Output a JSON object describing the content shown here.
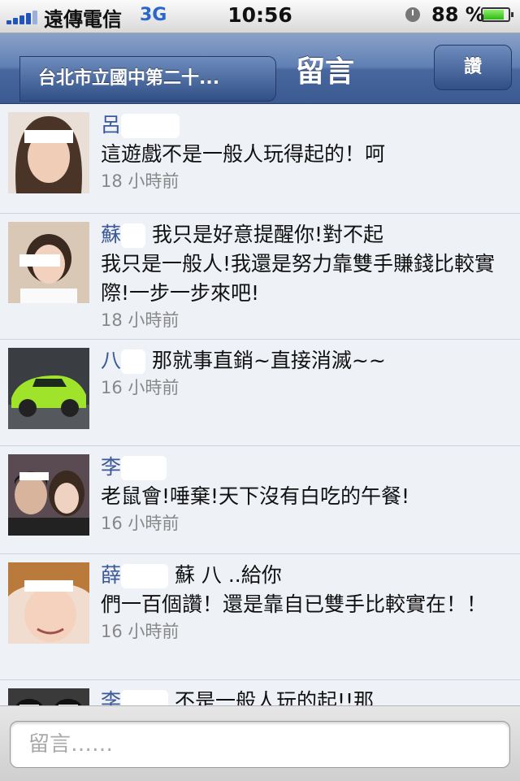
{
  "status_bar": {
    "carrier": "遠傳電信",
    "network": "3G",
    "time": "10:56",
    "battery_percent": "88 %",
    "battery_level": 0.88
  },
  "nav": {
    "back_label": "台北市立國中第二十...",
    "title": "留言",
    "like_label": "讚"
  },
  "comments": [
    {
      "name": "呂",
      "line1": "",
      "text": "這遊戲不是一般人玩得起的！呵",
      "time": "18 小時前",
      "avatar": "woman-photo"
    },
    {
      "name": "蘇",
      "line1": "我只是好意提醒你!對不起",
      "text": "我只是一般人!我還是努力靠雙手賺錢比較實際!一步一步來吧!",
      "time": "18 小時前",
      "avatar": "woman-photo"
    },
    {
      "name": "八",
      "line1": "那就事直銷~直接消滅~~",
      "text": "",
      "time": "16 小時前",
      "avatar": "green-car-photo"
    },
    {
      "name": "李",
      "line1": "",
      "text": "老鼠會!唾棄!天下沒有白吃的午餐!",
      "time": "16 小時前",
      "avatar": "couple-photo"
    },
    {
      "name": "薛",
      "line1": "蘇 八 ..給你",
      "text": "們一百個讚！還是靠自已雙手比較實在！！",
      "time": "16 小時前",
      "avatar": "woman-photo"
    },
    {
      "name": "李",
      "line1": "不是一般人玩的起!!那",
      "text": "",
      "time": "",
      "avatar": "group-photo"
    }
  ],
  "composer": {
    "placeholder": "留言……"
  },
  "colors": {
    "nav": "#4a6aa5",
    "name": "#3b5998",
    "time": "#888888",
    "background": "#eef1f6"
  }
}
